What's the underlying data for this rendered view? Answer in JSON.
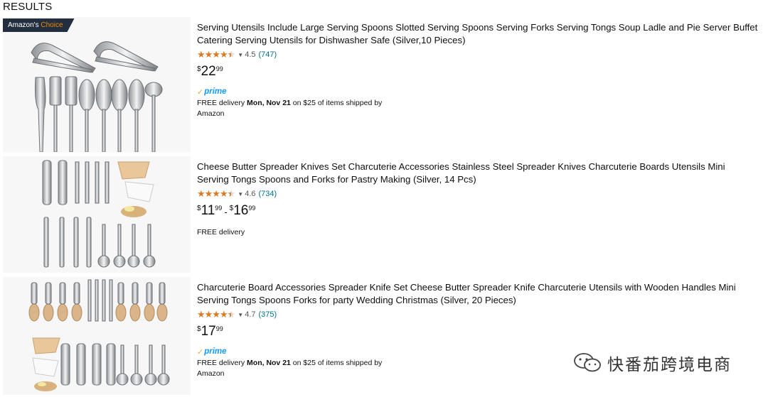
{
  "header": {
    "label": "RESULTS"
  },
  "results": [
    {
      "badge": {
        "prefix": "Amazon's",
        "accent": "Choice"
      },
      "title": "Serving Utensils Include Large Serving Spoons Slotted Serving Spoons Serving Forks Serving Tongs Soup Ladle and Pie Server Buffet Catering Serving Utensils for Dishwasher Safe (Silver,10 Pieces)",
      "rating": "4.5",
      "reviews": "(747)",
      "price": {
        "symbol": "$",
        "whole": "22",
        "fraction": "99"
      },
      "prime": "prime",
      "delivery": {
        "prefix": "FREE delivery ",
        "date": "Mon, Nov 21",
        "suffix": " on $25 of items shipped by Amazon"
      }
    },
    {
      "title": "Cheese Butter Spreader Knives Set Charcuterie Accessories Stainless Steel Spreader Knives Charcuterie Boards Utensils Mini Serving Tongs Spoons and Forks for Pastry Making (Silver, 14 Pcs)",
      "rating": "4.6",
      "reviews": "(734)",
      "price_low": {
        "symbol": "$",
        "whole": "11",
        "fraction": "99"
      },
      "price_dash": "-",
      "price_high": {
        "symbol": "$",
        "whole": "16",
        "fraction": "99"
      },
      "delivery_text": "FREE delivery"
    },
    {
      "title": "Charcuterie Board Accessories Spreader Knife Set Cheese Butter Spreader Knife Charcuterie Utensils with Wooden Handles Mini Serving Tongs Spoons Forks for party Wedding Christmas (Silver, 20 Pieces)",
      "rating": "4.7",
      "reviews": "(375)",
      "price": {
        "symbol": "$",
        "whole": "17",
        "fraction": "99"
      },
      "prime": "prime",
      "delivery": {
        "prefix": "FREE delivery ",
        "date": "Mon, Nov 21",
        "suffix": " on $25 of items shipped by Amazon"
      }
    }
  ],
  "watermark": {
    "text": "快番茄跨境电商"
  },
  "colors": {
    "star": "#de7921",
    "link": "#007185",
    "prime": "#1399ff",
    "badge_bg": "#232f3e",
    "badge_accent": "#f08804"
  },
  "icons": {
    "rating": "star-icon",
    "prime_check": "prime-check-icon",
    "watermark": "wechat-icon"
  }
}
